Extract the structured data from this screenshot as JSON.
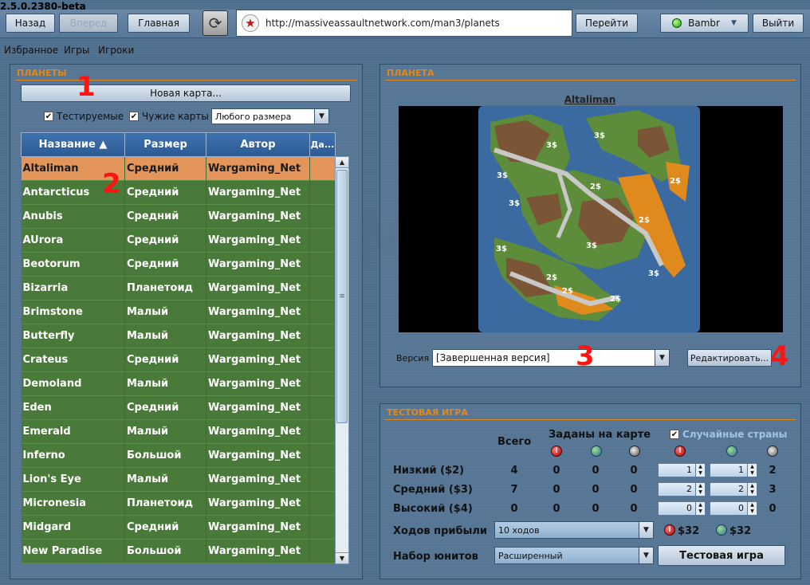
{
  "app": {
    "version": "2.5.0.2380-beta"
  },
  "toolbar": {
    "back_label": "Назад",
    "forward_label": "Вперед",
    "home_label": "Главная",
    "url": "http://massiveassaultnetwork.com/man3/planets",
    "go_label": "Перейти",
    "user_name": "Bambr",
    "logout_label": "Выйти"
  },
  "nav": {
    "items": [
      "Избранное",
      "Игры",
      "Игроки"
    ]
  },
  "planets_panel": {
    "title": "ПЛАНЕТЫ",
    "new_map_label": "Новая карта...",
    "filter_testable_label": "Тестируемые",
    "filter_foreign_label": "Чужие карты",
    "size_filter_value": "Любого размера",
    "columns": [
      "Название",
      "Размер",
      "Автор",
      "Да..."
    ],
    "rows": [
      [
        "Altaliman",
        "Средний",
        "Wargaming_Net"
      ],
      [
        "Antarcticus",
        "Средний",
        "Wargaming_Net"
      ],
      [
        "Anubis",
        "Средний",
        "Wargaming_Net"
      ],
      [
        "AUrora",
        "Средний",
        "Wargaming_Net"
      ],
      [
        "Beotorum",
        "Средний",
        "Wargaming_Net"
      ],
      [
        "Bizarria",
        "Планетоид",
        "Wargaming_Net"
      ],
      [
        "Brimstone",
        "Малый",
        "Wargaming_Net"
      ],
      [
        "Butterfly",
        "Малый",
        "Wargaming_Net"
      ],
      [
        "Crateus",
        "Средний",
        "Wargaming_Net"
      ],
      [
        "Demoland",
        "Малый",
        "Wargaming_Net"
      ],
      [
        "Eden",
        "Средний",
        "Wargaming_Net"
      ],
      [
        "Emerald",
        "Малый",
        "Wargaming_Net"
      ],
      [
        "Inferno",
        "Большой",
        "Wargaming_Net"
      ],
      [
        "Lion's Eye",
        "Малый",
        "Wargaming_Net"
      ],
      [
        "Micronesia",
        "Планетоид",
        "Wargaming_Net"
      ],
      [
        "Midgard",
        "Средний",
        "Wargaming_Net"
      ],
      [
        "New Paradise",
        "Большой",
        "Wargaming_Net"
      ]
    ],
    "selected_index": 0
  },
  "planet_panel": {
    "title": "ПЛАНЕТА",
    "planet_name": "Altaliman",
    "version_label": "Версия",
    "version_value": "[Завершенная версия]",
    "edit_label": "Редактировать..."
  },
  "map_labels": [
    "3$",
    "3$",
    "3$",
    "3$",
    "3$",
    "3$",
    "3$",
    "2$",
    "2$",
    "2$",
    "2$",
    "2$",
    "2$"
  ],
  "test_panel": {
    "title": "ТЕСТОВАЯ ИГРА",
    "total_header": "Всего",
    "on_map_header": "Заданы на карте",
    "random_countries_label": "Случайные страны",
    "rows": [
      {
        "label": "Низкий ($2)",
        "total": "4",
        "m1": "0",
        "m2": "0",
        "m3": "0",
        "s1": "1",
        "s2": "1",
        "r": "2"
      },
      {
        "label": "Средний ($3)",
        "total": "7",
        "m1": "0",
        "m2": "0",
        "m3": "0",
        "s1": "2",
        "s2": "2",
        "r": "3"
      },
      {
        "label": "Высокий ($4)",
        "total": "0",
        "m1": "0",
        "m2": "0",
        "m3": "0",
        "s1": "0",
        "s2": "0",
        "r": "0"
      }
    ],
    "income_label": "Ходов прибыли",
    "income_value": "10 ходов",
    "income_red": "$32",
    "income_green": "$32",
    "unit_set_label": "Набор юнитов",
    "unit_set_value": "Расширенный",
    "test_game_label": "Тестовая игра"
  },
  "markers": [
    "1",
    "2",
    "3",
    "4"
  ]
}
